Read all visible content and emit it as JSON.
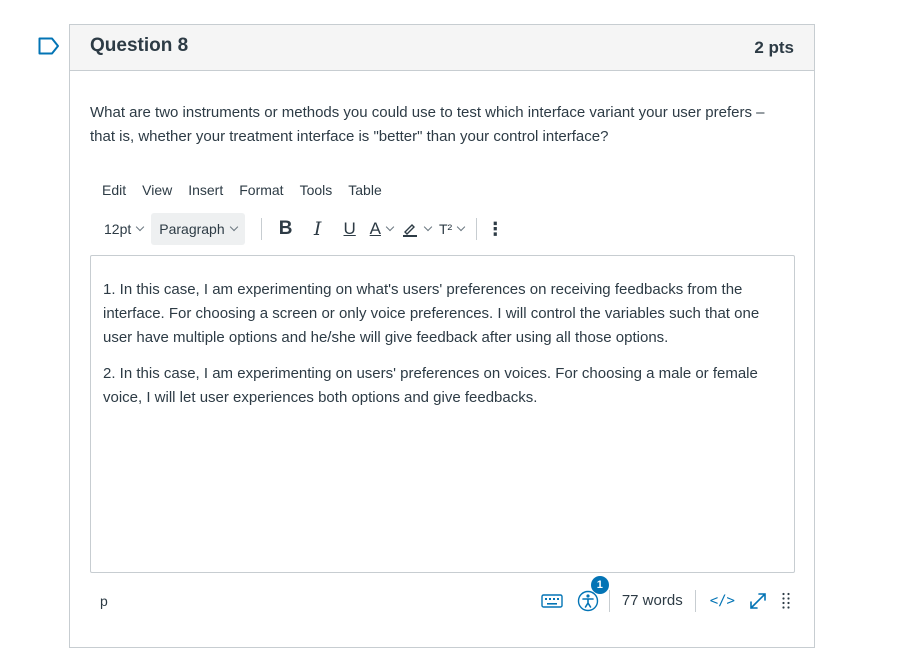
{
  "question": {
    "title": "Question 8",
    "points": "2 pts",
    "prompt": "What are two instruments or methods you could use to test which interface variant your user prefers – that is, whether your treatment interface is \"better\" than your control interface?"
  },
  "editor_menu": {
    "items": [
      "Edit",
      "View",
      "Insert",
      "Format",
      "Tools",
      "Table"
    ]
  },
  "toolbar": {
    "font_size": "12pt",
    "block_format": "Paragraph",
    "bold_glyph": "B",
    "italic_glyph": "I",
    "underline_glyph": "U",
    "text_color_glyph": "A",
    "superscript_glyph": "T²",
    "more_glyph": "⋮"
  },
  "answer": {
    "paragraphs": [
      "1. In this case, I am experimenting on what's users' preferences on receiving feedbacks from the interface. For choosing a screen or only voice preferences. I will control the variables such that one user have multiple options and he/she will give feedback after using all those options.",
      "2. In this case, I am experimenting on users' preferences on voices. For choosing a male or female voice, I will let user experiences both options and give feedbacks."
    ]
  },
  "status_bar": {
    "element_path": "p",
    "a11y_issue_count": "1",
    "word_count": "77 words",
    "html_toggle": "</>",
    "drag_handle": "⁙"
  },
  "icons": {
    "flag": "bookmark-flag-icon",
    "keyboard": "keyboard-icon",
    "accessibility": "accessibility-checker-icon",
    "fullscreen": "fullscreen-icon"
  },
  "colors": {
    "accent": "#0374b5",
    "text": "#2d3b45",
    "border": "#c7cdd1",
    "header_bg": "#f5f5f5"
  }
}
